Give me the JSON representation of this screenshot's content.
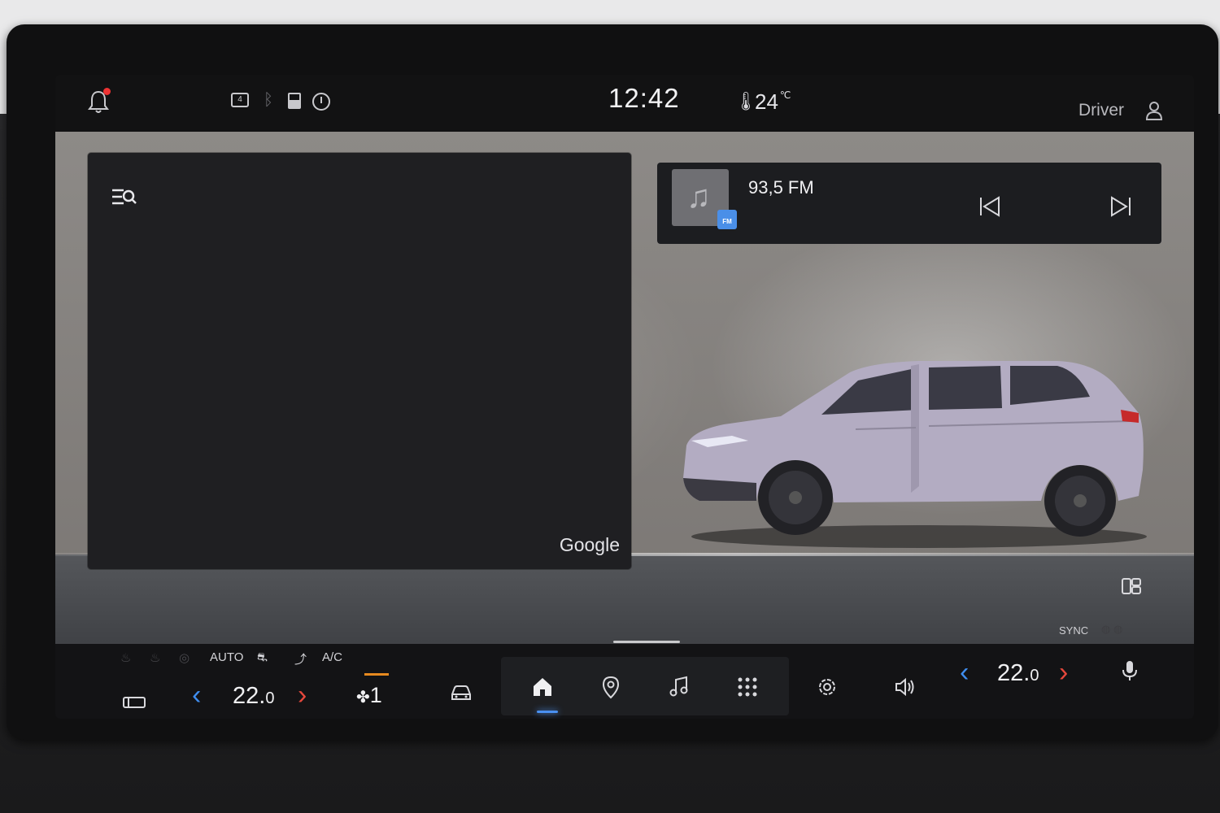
{
  "status_bar": {
    "message_count": "4",
    "time": "12:42",
    "outside_temp": "24",
    "outside_temp_unit": "℃",
    "profile_name": "Driver"
  },
  "map": {
    "provider_label": "Google"
  },
  "media": {
    "station": "93,5 FM",
    "source_badge": "FM"
  },
  "climate": {
    "auto_label": "AUTO",
    "ac_label": "A/C",
    "sync_label": "SYNC",
    "driver_temp_whole": "22.",
    "driver_temp_decimal": "0",
    "passenger_temp_whole": "22.",
    "passenger_temp_decimal": "0",
    "fan_level": "1"
  },
  "icons": {
    "status": [
      "bell-icon",
      "message-icon",
      "bluetooth-icon",
      "card-icon",
      "power-icon",
      "thermometer-icon",
      "person-icon"
    ],
    "dock": [
      "car-icon",
      "home-icon",
      "location-icon",
      "music-icon",
      "apps-icon",
      "gear-icon",
      "volume-icon",
      "mic-icon"
    ]
  },
  "colors": {
    "accent_blue": "#3f8ef0",
    "accent_red": "#e6483c",
    "fan_indicator": "#e68a1f",
    "notification_dot": "#e33333"
  }
}
